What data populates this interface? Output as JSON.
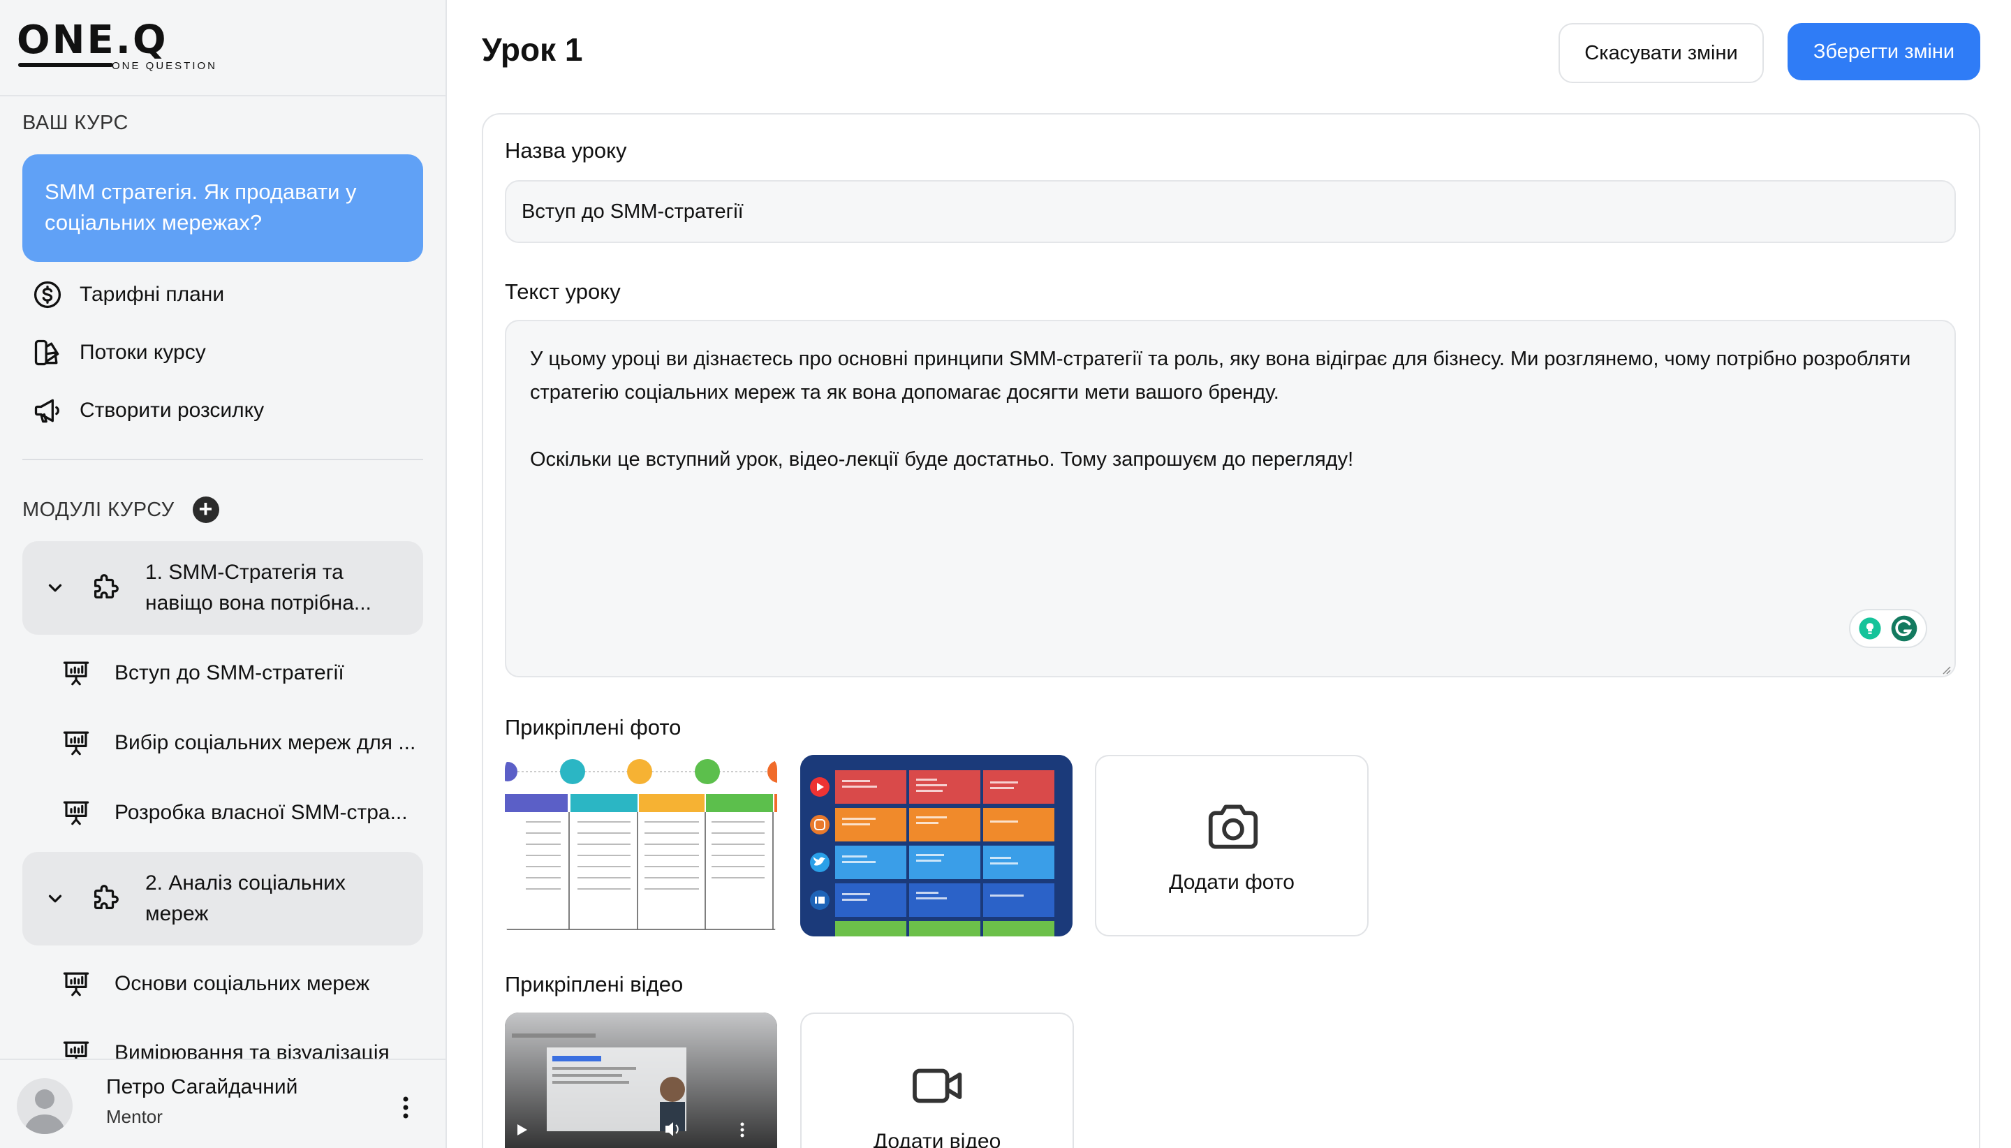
{
  "brand": {
    "logo": "ONE.Q",
    "tagline": "ONE QUESTION"
  },
  "sidebar": {
    "your_course_label": "ВАШ КУРС",
    "course_title": "SMM стратегія. Як продавати у соціальних мережах?",
    "menu": [
      {
        "label": "Тарифні плани",
        "icon": "dollar-circle-icon"
      },
      {
        "label": "Потоки курсу",
        "icon": "layers-icon"
      },
      {
        "label": "Створити розсилку",
        "icon": "megaphone-icon"
      }
    ],
    "modules_label": "МОДУЛІ КУРСУ",
    "modules": [
      {
        "title": "1. SMM-Стратегія та навіщо вона потрібна...",
        "lessons": [
          "Вступ до SMM-стратегії",
          "Вибір соціальних мереж для ...",
          "Розробка власної SMM-стра..."
        ]
      },
      {
        "title": "2. Аналіз соціальних мереж",
        "lessons": [
          "Основи соціальних мереж",
          "Вимірювання та візуалізація"
        ]
      }
    ],
    "user": {
      "name": "Петро Сагайдачний",
      "role": "Mentor"
    }
  },
  "header": {
    "title": "Урок 1",
    "cancel_label": "Скасувати зміни",
    "save_label": "Зберегти зміни"
  },
  "form": {
    "lesson_name_label": "Назва уроку",
    "lesson_name_value": "Вступ до SMM-стратегії",
    "lesson_text_label": "Текст уроку",
    "lesson_text_p1": "У цьому уроці ви дізнаєтесь про основні принципи SMM-стратегії та роль, яку вона відіграє для бізнесу. Ми розглянемо, чому потрібно розробляти стратегію соціальних мереж та як вона допомагає досягти мети вашого бренду.",
    "lesson_text_p2": "Оскільки це вступний урок, відео-лекції буде достатньо. Тому запрошуєм до перегляду!",
    "photos_label": "Прикріплені фото",
    "add_photo_label": "Додати фото",
    "videos_label": "Прикріплені відео",
    "add_video_label": "Додати відео"
  },
  "colors": {
    "accent": "#2f7cf6",
    "course_card": "#60a1f6",
    "sidebar_bg": "#f4f5f6"
  }
}
